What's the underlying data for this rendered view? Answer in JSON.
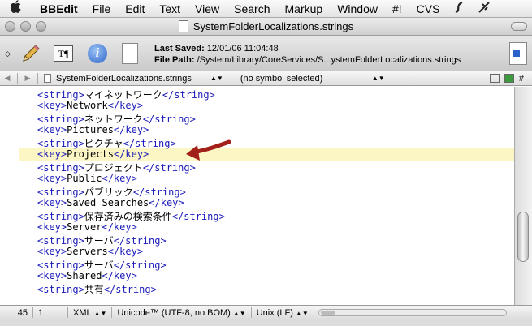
{
  "menubar": {
    "apple_icon": "apple-icon",
    "items": [
      "BBEdit",
      "File",
      "Edit",
      "Text",
      "View",
      "Search",
      "Markup",
      "Window",
      "#!",
      "CVS"
    ]
  },
  "window": {
    "title": "SystemFolderLocalizations.strings"
  },
  "toolbar": {
    "last_saved_label": "Last Saved:",
    "last_saved_value": "12/01/06 11:04:48",
    "file_path_label": "File Path:",
    "file_path_value": "/System/Library/CoreServices/S...ystemFolderLocalizations.strings"
  },
  "navbar": {
    "file_name": "SystemFolderLocalizations.strings",
    "symbol": "(no symbol selected)",
    "hash": "#"
  },
  "editor": {
    "lines": [
      {
        "tag": "string",
        "text": "マイネットワーク"
      },
      {
        "tag": "key",
        "text": "Network"
      },
      {
        "tag": "string",
        "text": "ネットワーク"
      },
      {
        "tag": "key",
        "text": "Pictures"
      },
      {
        "tag": "string",
        "text": "ピクチャ"
      },
      {
        "tag": "key",
        "text": "Projects"
      },
      {
        "tag": "string",
        "text": "プロジェクト"
      },
      {
        "tag": "key",
        "text": "Public"
      },
      {
        "tag": "string",
        "text": "パブリック"
      },
      {
        "tag": "key",
        "text": "Saved Searches"
      },
      {
        "tag": "string",
        "text": "保存済みの検索条件"
      },
      {
        "tag": "key",
        "text": "Server"
      },
      {
        "tag": "string",
        "text": "サーバ"
      },
      {
        "tag": "key",
        "text": "Servers"
      },
      {
        "tag": "string",
        "text": "サーバ"
      },
      {
        "tag": "key",
        "text": "Shared"
      },
      {
        "tag": "string",
        "text": "共有"
      }
    ],
    "highlight_color": "#fbf6c4",
    "arrow_color": "#a3201a"
  },
  "statusbar": {
    "line": "45",
    "column": "1",
    "language": "XML",
    "encoding": "Unicode™ (UTF-8, no BOM)",
    "line_endings": "Unix (LF)"
  }
}
